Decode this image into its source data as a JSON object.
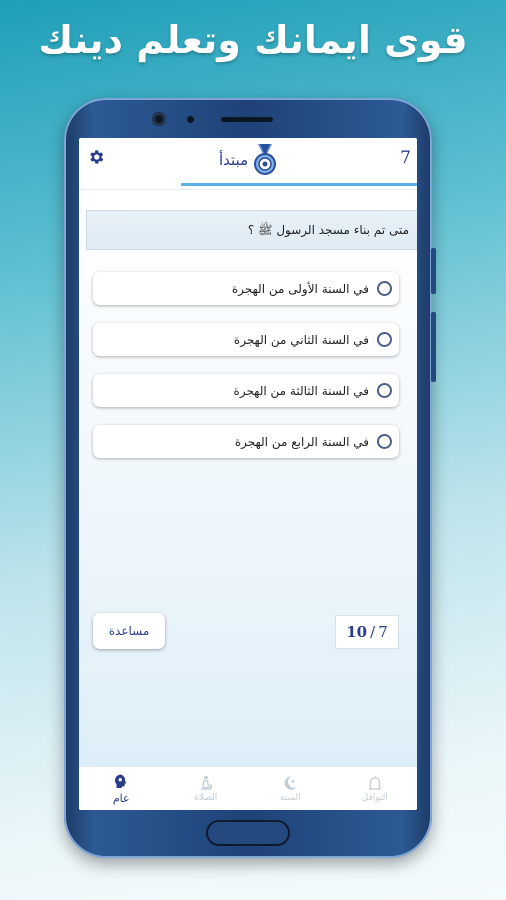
{
  "headline": "قوى ايمانك وتعلم دينك",
  "appbar": {
    "level_number": "7",
    "level_label": "مبتدأ",
    "gear_icon": "gear-icon",
    "medal_icon": "medal-icon"
  },
  "quiz": {
    "question": "متى تم بناء مسجد الرسول ﷺ ؟",
    "options": [
      {
        "label": "في السنة الأولى من الهجرة"
      },
      {
        "label": "في السنة الثاني من الهجرة"
      },
      {
        "label": "في السنة الثالثة من الهجرة"
      },
      {
        "label": "في السنة الرابع من الهجرة"
      }
    ],
    "help_label": "مساعدة",
    "counter_total": "10",
    "counter_separator": "/",
    "counter_current": "7"
  },
  "bottom_nav": {
    "items": [
      {
        "label": "عام",
        "icon": "head-icon",
        "active": true
      },
      {
        "label": "الصلاة",
        "icon": "prayer-icon",
        "active": false
      },
      {
        "label": "السنة",
        "icon": "crescent-icon",
        "active": false
      },
      {
        "label": "النوافل",
        "icon": "mosque-icon",
        "active": false
      }
    ]
  },
  "colors": {
    "accent": "#2a3d8c",
    "tab_underline": "#5bb0e4",
    "phone_body": "#1e4278"
  }
}
